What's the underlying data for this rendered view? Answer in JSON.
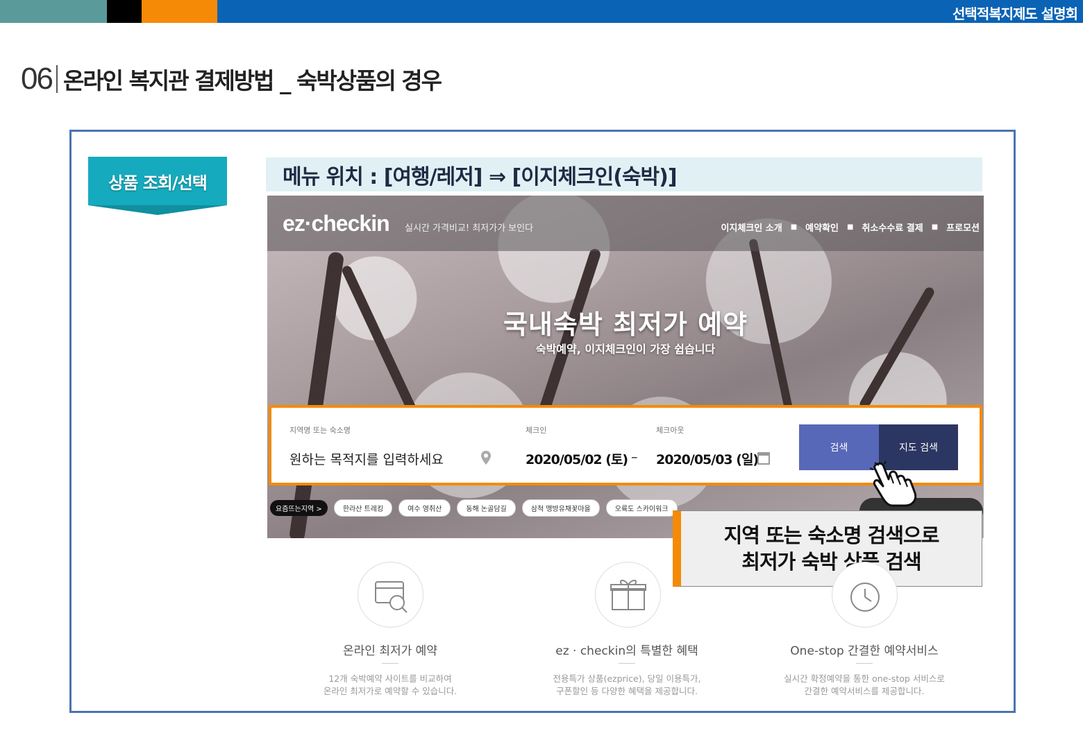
{
  "header": {
    "brand": "선택적복지제도 설명회"
  },
  "slide": {
    "number": "06",
    "title": "온라인 복지관 결제방법 _ 숙박상품의 경우"
  },
  "section": {
    "badge": "상품 조회/선택",
    "menu_path": "메뉴 위치 : [여행/레저] ⇒ [이지체크인(숙박)]"
  },
  "site": {
    "logo": "ez·checkin",
    "slogan": "실시간 가격비교! 최저가가 보인다",
    "nav": [
      "이지체크인 소개",
      "예약확인",
      "취소수수료 결제",
      "프로모션"
    ],
    "hero_title": "국내숙박 최저가 예약",
    "hero_subtitle": "숙박예약, 이지체크인이 가장 쉽습니다",
    "search": {
      "destination_label": "지역명 또는 숙소명",
      "destination_placeholder": "원하는 목적지를 입력하세요",
      "checkin_label": "체크인",
      "checkin_value": "2020/05/02 (토)",
      "separator": "–",
      "checkout_label": "체크아웃",
      "checkout_value": "2020/05/03 (일)",
      "search_button": "검색",
      "map_button": "지도 검색"
    },
    "hot_label": "요즘뜨는지역 >",
    "tags": [
      "한라산 트레킹",
      "여수 영취산",
      "동해 논골담길",
      "삼척 맹방유채꽃마을",
      "오륙도 스카이워크"
    ]
  },
  "callout": {
    "line1": "지역 또는 숙소명 검색으로",
    "line2": "최저가 숙박 상품 검색"
  },
  "features": [
    {
      "icon": "price-compare-icon",
      "title": "온라인 최저가 예약",
      "desc1": "12개 숙박예약 사이트를 비교하여",
      "desc2": "온라인 최저가로 예약할 수 있습니다."
    },
    {
      "icon": "gift-icon",
      "title": "ez · checkin의 특별한 혜택",
      "desc1": "전용특가 상품(ezprice), 당일 이용특가,",
      "desc2": "구폰할인 등 다양한 혜택을 제공합니다."
    },
    {
      "icon": "clock-icon",
      "title": "One-stop 간결한 예약서비스",
      "desc1": "실시간 확정예약을 통한 one-stop 서비스로",
      "desc2": "간결한 예약서비스를 제공합니다."
    }
  ],
  "colors": {
    "top_bar": "#0a63b5",
    "accent_orange": "#f58a07",
    "frame_border": "#4a74b2",
    "badge": "#15aabd",
    "search_button": "#5868b8",
    "map_button": "#2c3662"
  }
}
